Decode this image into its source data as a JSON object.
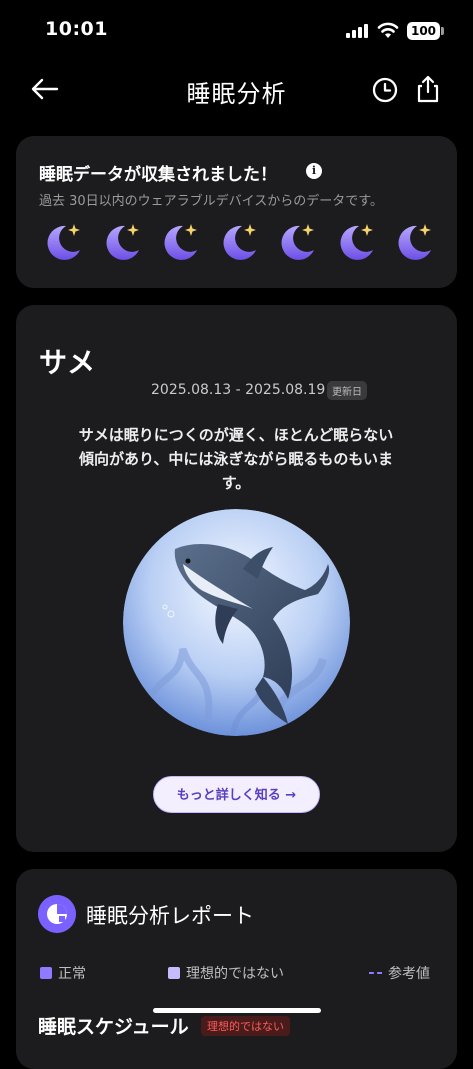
{
  "status": {
    "time": "10:01",
    "battery": "100"
  },
  "nav": {
    "title": "睡眠分析"
  },
  "collect": {
    "title": "睡眠データが収集されました！",
    "info_icon_glyph": "i",
    "subtitle": "過去 30日以内のウェアラブルデバイスからのデータです。",
    "moon_count": 7
  },
  "animal": {
    "title": "サメ",
    "date_range": "2025.08.13 - 2025.08.19",
    "updated_badge": "更新日",
    "description": "サメは眠りにつくのが遅く、ほとんど眠らない傾向があり、中には泳ぎながら眠るものもいます。",
    "more_button": "もっと詳しく知る →"
  },
  "report": {
    "title": "睡眠分析レポート",
    "legend": [
      {
        "label": "正常",
        "color": "#8f7bff"
      },
      {
        "label": "理想的ではない",
        "color": "#c7bbff"
      },
      {
        "label": "参考値",
        "color": "#8f7bff"
      }
    ],
    "schedule_label": "睡眠スケジュール",
    "schedule_badge": "理想的ではない"
  },
  "colors": {
    "accent": "#7b61ff",
    "card_bg": "#1c1c1e",
    "button_bg": "#f3efff"
  }
}
